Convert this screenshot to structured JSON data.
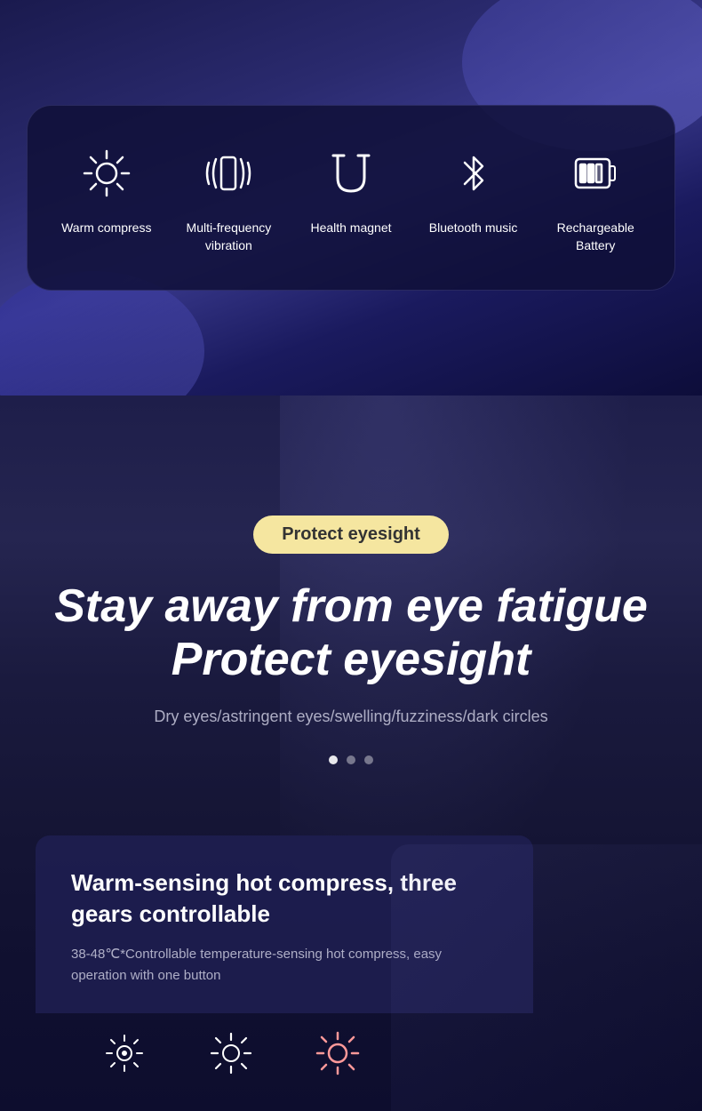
{
  "top": {
    "features": [
      {
        "id": "warm-compress",
        "label": "Warm compress",
        "icon": "sun"
      },
      {
        "id": "multi-freq",
        "label": "Multi-frequency vibration",
        "icon": "vibration"
      },
      {
        "id": "health-magnet",
        "label": "Health magnet",
        "icon": "magnet"
      },
      {
        "id": "bluetooth",
        "label": "Bluetooth music",
        "icon": "bluetooth"
      },
      {
        "id": "battery",
        "label": "Rechargeable Battery",
        "icon": "battery"
      }
    ]
  },
  "bottom": {
    "badge": "Protect eyesight",
    "main_title_line1": "Stay away from eye fatigue",
    "main_title_line2": "Protect eyesight",
    "subtitle": "Dry eyes/astringent eyes/swelling/fuzziness/dark circles",
    "dots": [
      {
        "active": true
      },
      {
        "active": false
      },
      {
        "active": false
      }
    ],
    "product_title": "Warm-sensing hot compress, three gears controllable",
    "product_desc": "38-48℃*Controllable temperature-sensing hot compress, easy operation with one button"
  }
}
